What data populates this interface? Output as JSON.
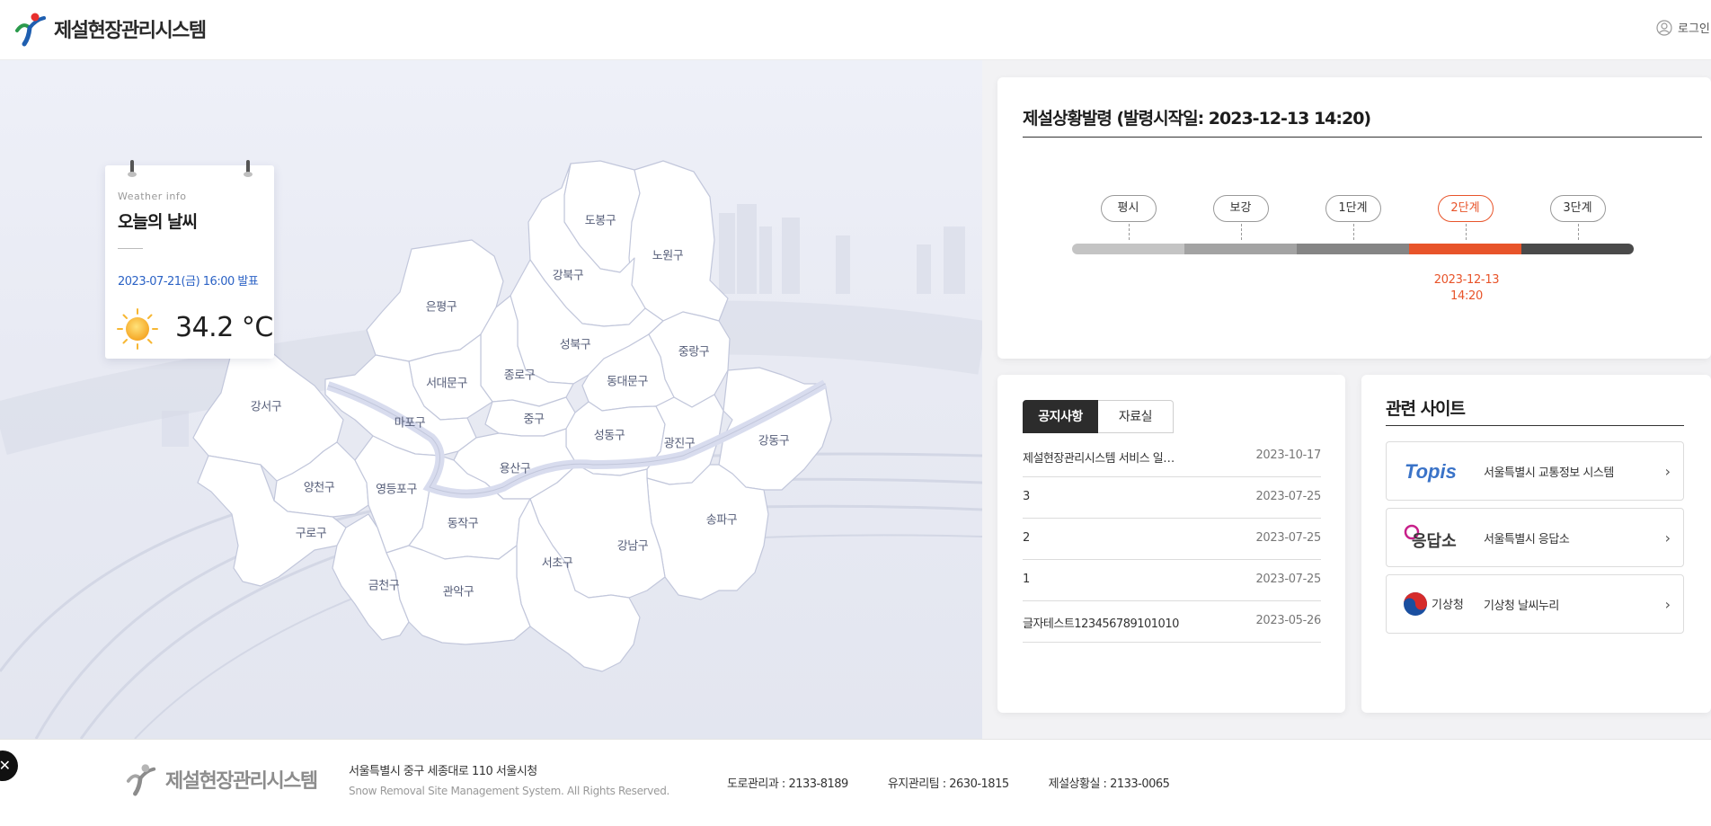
{
  "header": {
    "app_title": "제설현장관리시스템",
    "login_label": "로그인"
  },
  "weather": {
    "eyebrow": "Weather info",
    "title": "오늘의 날씨",
    "issued": "2023-07-21(금) 16:00 발표",
    "temperature": "34.2 °C",
    "icon": "sun-icon"
  },
  "map": {
    "districts": [
      {
        "name": "도봉구"
      },
      {
        "name": "노원구"
      },
      {
        "name": "강북구"
      },
      {
        "name": "은평구"
      },
      {
        "name": "성북구"
      },
      {
        "name": "중랑구"
      },
      {
        "name": "종로구"
      },
      {
        "name": "서대문구"
      },
      {
        "name": "동대문구"
      },
      {
        "name": "강서구"
      },
      {
        "name": "마포구"
      },
      {
        "name": "중구"
      },
      {
        "name": "성동구"
      },
      {
        "name": "광진구"
      },
      {
        "name": "강동구"
      },
      {
        "name": "용산구"
      },
      {
        "name": "양천구"
      },
      {
        "name": "영등포구"
      },
      {
        "name": "동작구"
      },
      {
        "name": "송파구"
      },
      {
        "name": "구로구"
      },
      {
        "name": "강남구"
      },
      {
        "name": "서초구"
      },
      {
        "name": "금천구"
      },
      {
        "name": "관악구"
      }
    ]
  },
  "status": {
    "title": "제설상황발령 (발령시작일: 2023-12-13 14:20)",
    "stages": [
      "평시",
      "보강",
      "1단계",
      "2단계",
      "3단계"
    ],
    "active_stage": "2단계",
    "active_date": "2023-12-13",
    "active_time": "14:20",
    "stage_colors": [
      "#c4c4c4",
      "#a3a3a3",
      "#858585",
      "#e8542a",
      "#4a4a4a"
    ]
  },
  "notice": {
    "tabs": [
      "공지사항",
      "자료실"
    ],
    "items": [
      {
        "title": "제설현장관리시스템 서비스 일…",
        "date": "2023-10-17"
      },
      {
        "title": "3",
        "date": "2023-07-25"
      },
      {
        "title": "2",
        "date": "2023-07-25"
      },
      {
        "title": "1",
        "date": "2023-07-25"
      },
      {
        "title": "글자테스트123456789101010",
        "date": "2023-05-26"
      }
    ]
  },
  "sites": {
    "title": "관련 사이트",
    "items": [
      {
        "name": "서울특별시 교통정보 시스템",
        "logo": "topis-logo",
        "logo_text": "Topis"
      },
      {
        "name": "서울특별시 응답소",
        "logo": "eungdapso-logo",
        "logo_text": "응답소"
      },
      {
        "name": "기상청 날씨누리",
        "logo": "kma-logo",
        "logo_text": "기상청"
      }
    ]
  },
  "footer": {
    "app_title": "제설현장관리시스템",
    "address": "서울특별시 중구 세종대로 110 서울시청",
    "copyright": "Snow Removal Site Management System. All Rights Reserved.",
    "contacts": [
      {
        "text": "도로관리과 : 2133-8189"
      },
      {
        "text": "유지관리팀 : 2630-1815"
      },
      {
        "text": "제설상황실 : 2133-0065"
      }
    ]
  }
}
